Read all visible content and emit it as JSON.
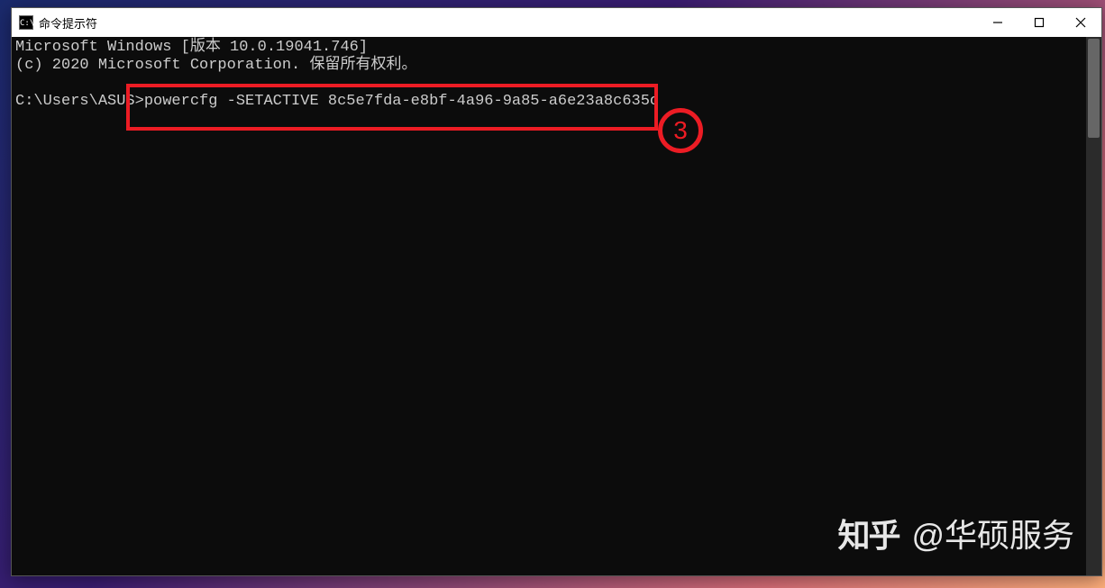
{
  "window": {
    "title": "命令提示符",
    "icon_text": "C:\\"
  },
  "terminal": {
    "line1": "Microsoft Windows [版本 10.0.19041.746]",
    "line2": "(c) 2020 Microsoft Corporation. 保留所有权利。",
    "prompt_prefix": "C:\\Users\\ASUS>",
    "command": "powercfg -SETACTIVE 8c5e7fda-e8bf-4a96-9a85-a6e23a8c635c"
  },
  "annotation": {
    "step_number": "3",
    "highlight_color": "#ec1c24"
  },
  "watermark": {
    "logo": "知乎",
    "text": "@华硕服务"
  }
}
